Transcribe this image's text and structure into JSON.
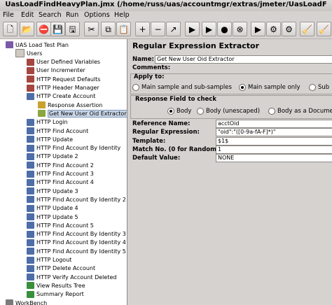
{
  "window": {
    "title": "UasLoadFindHeavyPlan.jmx (/home/russ/uas/accountmgr/extras/jmeter/UasLoadF"
  },
  "menubar": {
    "items": [
      {
        "label": "File"
      },
      {
        "label": "Edit"
      },
      {
        "label": "Search"
      },
      {
        "label": "Run"
      },
      {
        "label": "Options"
      },
      {
        "label": "Help"
      }
    ]
  },
  "toolbar": {
    "buttons": [
      {
        "name": "new-icon",
        "glyph": "🗋"
      },
      {
        "name": "open-icon",
        "glyph": "📂"
      },
      {
        "name": "stop-icon",
        "glyph": "⛔"
      },
      {
        "name": "save-icon",
        "glyph": "💾"
      },
      {
        "name": "save-as-icon",
        "glyph": "🖫"
      },
      {
        "name": "cut-icon",
        "glyph": "✂"
      },
      {
        "name": "copy-icon",
        "glyph": "⧉"
      },
      {
        "name": "paste-icon",
        "glyph": "📋"
      },
      {
        "name": "expand-icon",
        "glyph": "+"
      },
      {
        "name": "collapse-icon",
        "glyph": "−"
      },
      {
        "name": "toggle-icon",
        "glyph": "↗"
      },
      {
        "name": "start-icon",
        "glyph": "▶"
      },
      {
        "name": "start-no-pause-icon",
        "glyph": "▶"
      },
      {
        "name": "stop-test-icon",
        "glyph": "●"
      },
      {
        "name": "shutdown-icon",
        "glyph": "⊗"
      },
      {
        "name": "remote-start-icon",
        "glyph": "▶"
      },
      {
        "name": "remote-stop-icon",
        "glyph": "⚙"
      },
      {
        "name": "remote-shutdown-icon",
        "glyph": "⚙"
      },
      {
        "name": "clear-icon",
        "glyph": "🧹"
      },
      {
        "name": "clear-all-icon",
        "glyph": "🧹"
      }
    ]
  },
  "tree": {
    "nodes": [
      {
        "label": "UAS Load Test Plan",
        "icon": "plan"
      },
      {
        "label": "Users",
        "icon": "grp"
      },
      {
        "label": "User Defined Variables",
        "icon": "cfg"
      },
      {
        "label": "User Incrementer",
        "icon": "cfg"
      },
      {
        "label": "HTTP Request Defaults",
        "icon": "cfg"
      },
      {
        "label": "HTTP Header Manager",
        "icon": "cfg"
      },
      {
        "label": "HTTP Create Account",
        "icon": "smp"
      },
      {
        "label": "Response Assertion",
        "icon": "ast"
      },
      {
        "label": "Get New User Oid Extractor",
        "icon": "post"
      },
      {
        "label": "HTTP Login",
        "icon": "smp"
      },
      {
        "label": "HTTP Find Account",
        "icon": "smp"
      },
      {
        "label": "HTTP Update",
        "icon": "smp"
      },
      {
        "label": "HTTP Find Account By Identity",
        "icon": "smp"
      },
      {
        "label": "HTTP Update 2",
        "icon": "smp"
      },
      {
        "label": "HTTP Find Account 2",
        "icon": "smp"
      },
      {
        "label": "HTTP Find Account 3",
        "icon": "smp"
      },
      {
        "label": "HTTP Find Account 4",
        "icon": "smp"
      },
      {
        "label": "HTTP Update 3",
        "icon": "smp"
      },
      {
        "label": "HTTP Find Account By Identity 2",
        "icon": "smp"
      },
      {
        "label": "HTTP Update 4",
        "icon": "smp"
      },
      {
        "label": "HTTP Update 5",
        "icon": "smp"
      },
      {
        "label": "HTTP Find Account 5",
        "icon": "smp"
      },
      {
        "label": "HTTP Find Account By Identity 3",
        "icon": "smp"
      },
      {
        "label": "HTTP Find Account By Identity 4",
        "icon": "smp"
      },
      {
        "label": "HTTP Find Account By Identity 5",
        "icon": "smp"
      },
      {
        "label": "HTTP Logout",
        "icon": "smp"
      },
      {
        "label": "HTTP Delete Account",
        "icon": "smp"
      },
      {
        "label": "HTTP Verify Account Deleted",
        "icon": "smp"
      },
      {
        "label": "View Results Tree",
        "icon": "lst"
      },
      {
        "label": "Summary Report",
        "icon": "lst"
      },
      {
        "label": "WorkBench",
        "icon": "wb"
      }
    ]
  },
  "panel": {
    "title": "Regular Expression Extractor",
    "name_label": "Name:",
    "name_value": "Get New User Oid Extractor",
    "comments_label": "Comments:",
    "apply_to_label": "Apply to:",
    "apply_opts": [
      "Main sample and sub-samples",
      "Main sample only",
      "Sub"
    ],
    "field_label": "Response Field to check",
    "field_opts": [
      "Body",
      "Body (unescaped)",
      "Body as a Docume"
    ],
    "ref_label": "Reference Name:",
    "ref_value": "acctOid",
    "regex_label": "Regular Expression:",
    "regex_value": "\"oid\":\"([0-9a-fA-F]*)\"",
    "template_label": "Template:",
    "template_value": "$1$",
    "match_label": "Match No. (0 for Random):",
    "match_value": "1",
    "default_label": "Default Value:",
    "default_value": "NONE"
  }
}
